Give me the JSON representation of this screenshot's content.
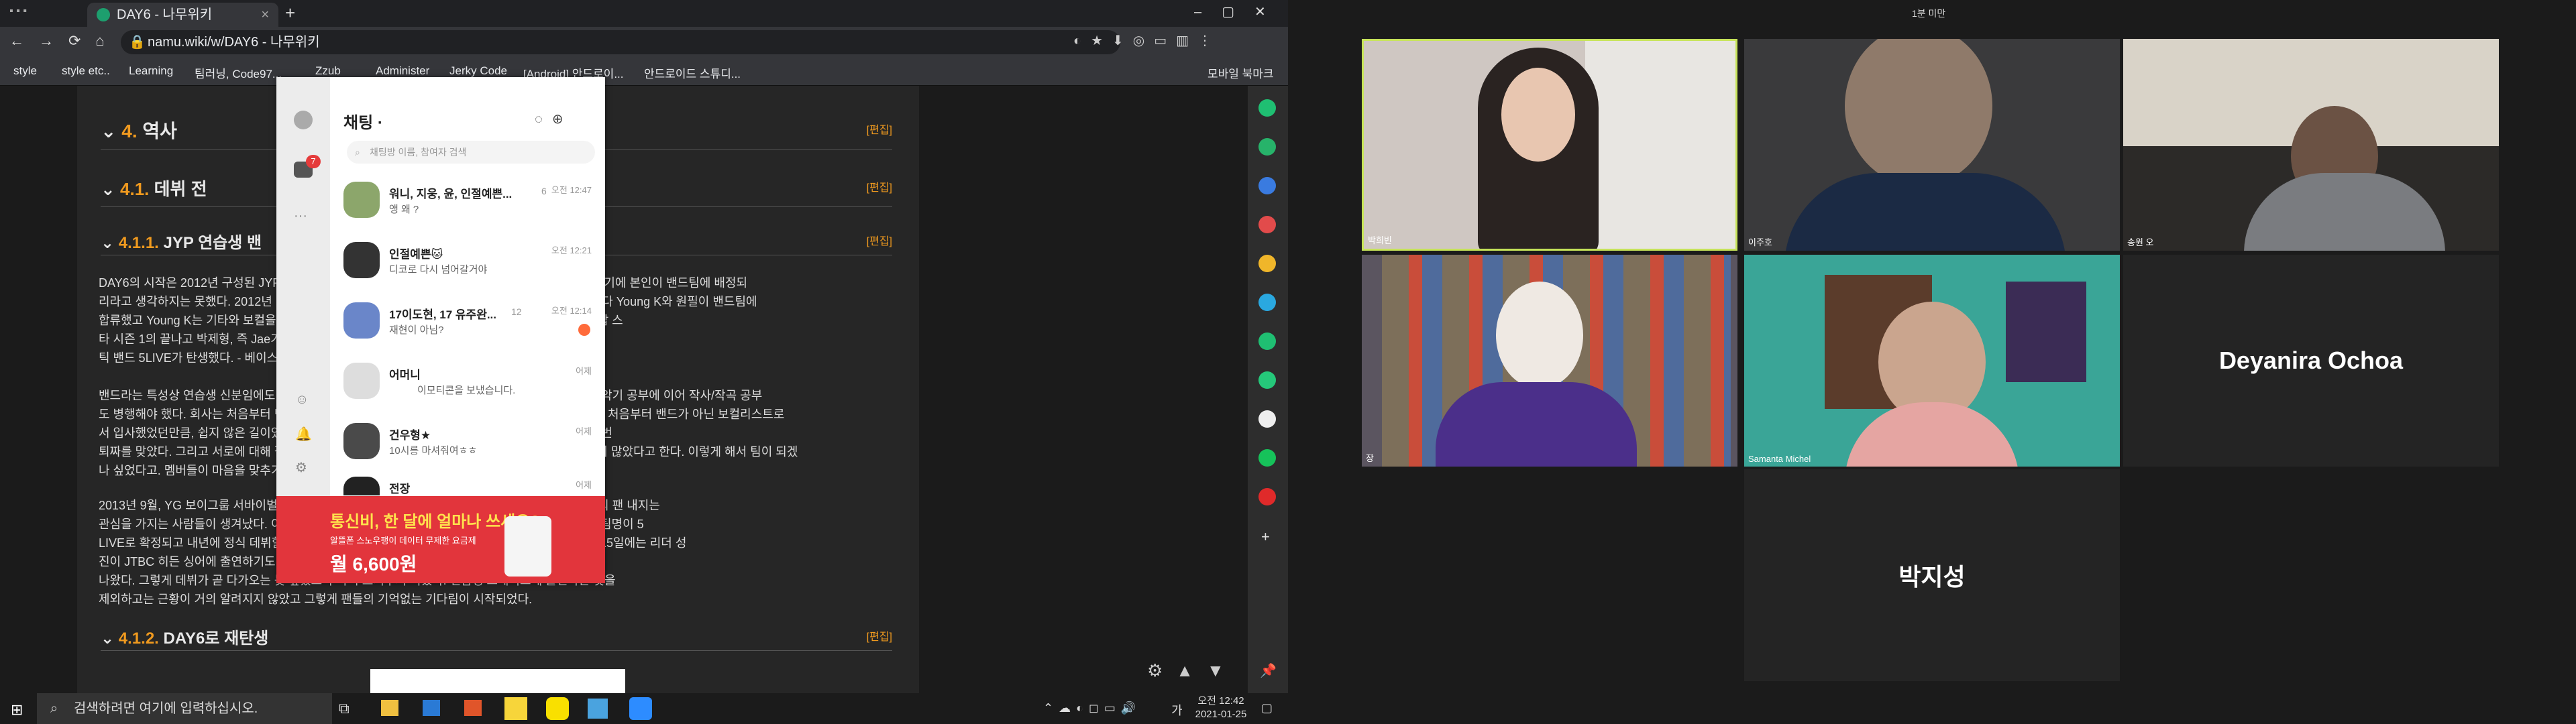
{
  "browser": {
    "tab_title": "DAY6 - 나무위키",
    "url": "namu.wiki/w/DAY6 - 나무위키",
    "bookmarks": [
      "style",
      "style etc..",
      "Learning",
      "팀러닝, Code97...",
      "Zzub",
      "Administer",
      "Jerky Code",
      "[Android] 안드로이...",
      "안드로이드 스튜디...",
      "모바일 북마크"
    ]
  },
  "article": {
    "sections": [
      {
        "num": "4.",
        "title": "역사",
        "edit": "[편집]"
      },
      {
        "num": "4.1.",
        "title": "데뷔 전",
        "edit": "[편집]"
      },
      {
        "num": "4.1.1.",
        "title": "JYP 연습생 밴",
        "edit": "[편집]"
      },
      {
        "num": "4.1.2.",
        "title": "DAY6로 재탄생",
        "edit": "[편집]"
      }
    ],
    "para1": [
      "DAY6의 시작은 2012년 구성된 JYP의 연습생 밴드에서 시작되었으며, 처음에는 보컬리스트로 입사했기에 본인이 밴드팀에 배정되",
      "리라고 생각하지는 못했다. 2012년 당시 JYP의 연습생 밴드는 5LIVE라는 이름의 댄스팀이었다. 그러다 Young K와 원필이 밴드팀에",
      "합류했고 Young K는 기타와 보컬을 맡아 활동하던 중 <Officially Missing You>. 2012년 5월 이후 K팝 스",
      "타 시즌 1의 끝나고 박제형, 즉 Jae가 밴드팀에 합류하게 된다. 그리하여 5인조 어쿠스",
      "틱 밴드 5LIVE가 탄생했다. - 베이스, 원필 - 신디사이저로 지금과 좀 달랐다."
    ],
    "para2": [
      "밴드라는 특성상 연습생 신분임에도 불구하고 자작곡 작업에 몰두했으며, 그룹 결성 초창기, 멤버들은 악기 공부에 이어 작사/작곡 공부",
      "도 병행해야 했다. 회사는 처음부터 밴드 음악을 목표로 삼았기에 이런 활동을 했지만, 멤버들 대부분이 처음부터 밴드가 아닌 보컬리스트로",
      "서 입사했었던만큼, 쉽지 않은 길이었다. 이 과정에서 2012년부터 한 달에 두 곡씩 써서 제출했지만 매번",
      "퇴짜를 맞았다. 그리고 서로에 대해 잘 알지 못하는 상태에서 합숙을 하게 된 탓에 멤버들 간에도 충돌이 많았다고 한다. 이렇게 해서 팀이 되겠",
      "나 싶었다고. 멤버들이 마음을 맞추기까지 시간이 걸렸다."
    ],
    "para3": [
      "2013년 9월, YG 보이그룹 서바이벌 프로그램 WIN에 출연하며 처음 이름을 알리게 되었고 이때 소수의 팬 내지는",
      "관심을 가지는 사람들이 생겨났다. 이후 멤버 변동이 있었고 양현석에게 말했었다. 같은 해 11월 20일 팀명이 5",
      "LIVE로 확정되고 내년에 정식 데뷔할 것이라는 보도가 나왔다. OST <Lovely Girl>에 참여하고 12월 15일에는 리더 성",
      "진이 JTBC 히든 싱어에 출연하기도 하였다. 5LIVE는 내년 초 데뷔 예정으로 보인다는 보도도",
      "나왔다. 그렇게 데뷔가 곧 다가오는 듯 싶었으나 다시 흐지부지 되었다. 연습생 쇼케이스에 출연하는 것을",
      "제외하고는 근황이 거의 알려지지 않았고 그렇게 팬들의 기억없는 기다림이 시작되었다."
    ]
  },
  "kakao": {
    "title": "채팅 ·",
    "search_placeholder": "채팅방 이름, 참여자 검색",
    "badge": "7",
    "chats": [
      {
        "name": "워니, 지웅, 윤, 인절예쁜...",
        "count": "6",
        "msg": "앵 왜 ?",
        "time": "오전 12:47"
      },
      {
        "name": "인절예쁜🐱",
        "count": "",
        "msg": "디코로 다시 넘어갈거야",
        "time": "오전 12:21"
      },
      {
        "name": "17이도현, 17 유주완...",
        "count": "12",
        "msg": "재현이 아님?",
        "time": "오전 12:14"
      },
      {
        "name": "어머니",
        "count": "",
        "msg": "이모티콘을 보냈습니다.",
        "time": "어제"
      },
      {
        "name": "건우형★",
        "count": "",
        "msg": "10시릉 마셔줘여ㅎㅎ",
        "time": "어제"
      },
      {
        "name": "전장",
        "count": "",
        "msg": "",
        "time": "어제"
      }
    ],
    "ad_line1": "통신비, 한 달에 얼마나 쓰세요?",
    "ad_line2": "알뜰폰 스노우팽이 데이터 무제한 요금제",
    "ad_price": "월 6,600원"
  },
  "taskbar": {
    "search_placeholder": "검색하려면 여기에 입력하십시오.",
    "time": "오전 12:42",
    "date": "2021-01-25",
    "ime": "가"
  },
  "zoom": {
    "top_label": "1분 미만",
    "participants": [
      {
        "name": "박희빈",
        "video": true
      },
      {
        "name": "이주호",
        "video": true
      },
      {
        "name": "송원 오",
        "video": true
      },
      {
        "name": "장",
        "video": true
      },
      {
        "name": "Samanta Michel",
        "video": true
      },
      {
        "name": "Deyanira Ochoa",
        "video": false
      },
      {
        "name": "박지성",
        "video": false
      }
    ]
  }
}
